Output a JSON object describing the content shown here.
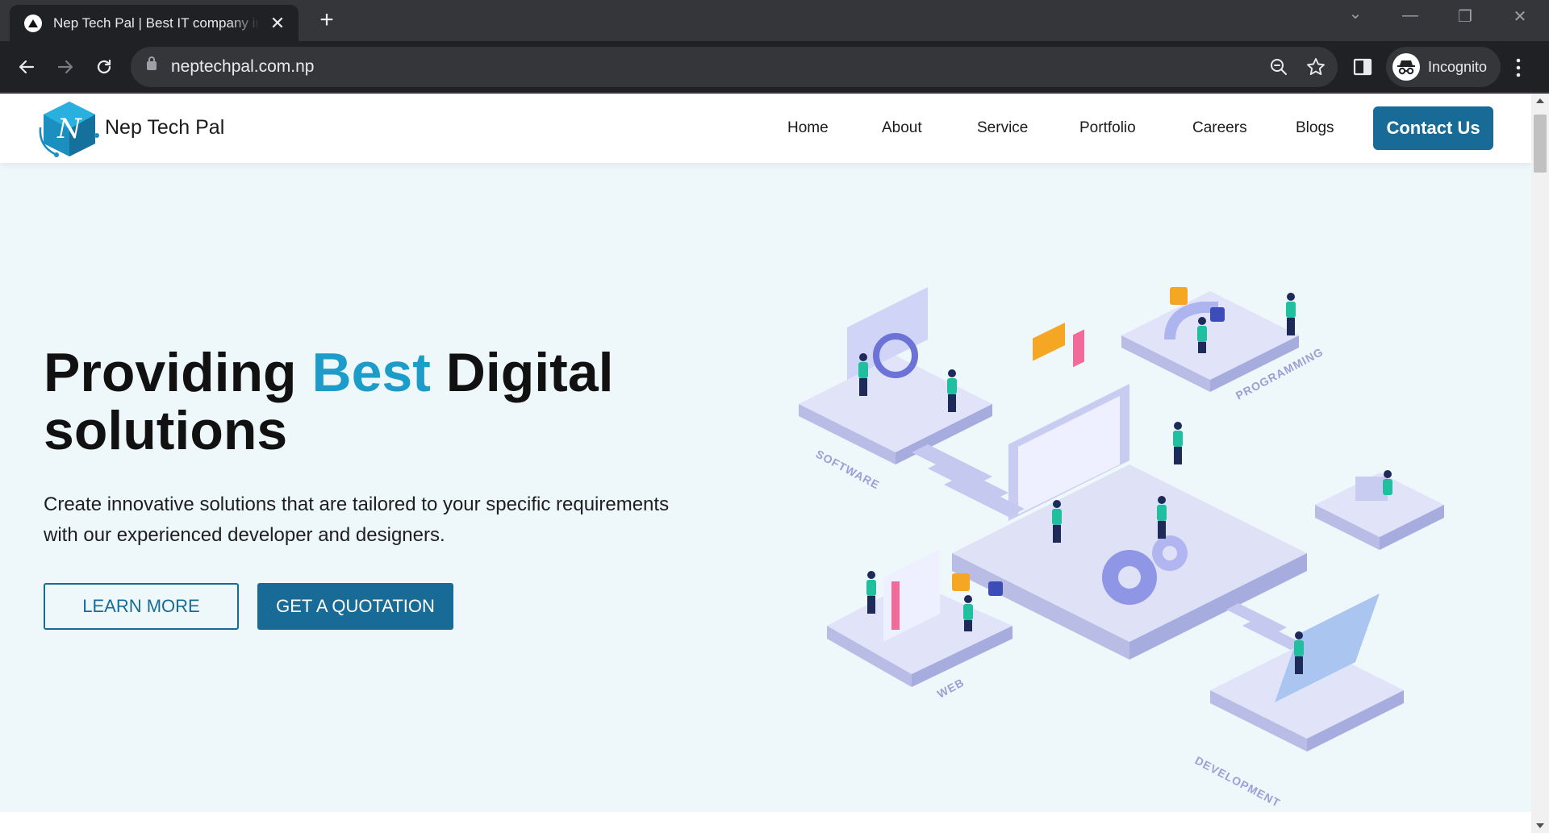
{
  "browser": {
    "tab_title": "Nep Tech Pal | Best IT company in Nepal",
    "tab_close": "✕",
    "new_tab": "+",
    "url": "neptechpal.com.np",
    "profile_label": "Incognito",
    "window_controls": {
      "tab_search": "⌄",
      "minimize": "—",
      "restore": "❐",
      "close": "✕"
    }
  },
  "site": {
    "brand": "Nep Tech Pal",
    "logo_letter": "N",
    "nav": [
      "Home",
      "About",
      "Service",
      "Portfolio",
      "Careers",
      "Blogs"
    ],
    "contact_label": "Contact Us"
  },
  "hero": {
    "title_part1": "Providing ",
    "title_accent": "Best",
    "title_part2": " Digital",
    "title_line2": "solutions",
    "subtitle": "Create innovative solutions that are tailored to your specific requirements with our experienced developer and designers.",
    "learn_more": "LEARN MORE",
    "quotation": "GET A QUOTATION",
    "illustration_labels": {
      "software": "SOFTWARE",
      "programming": "PROGRAMMING",
      "web": "WEB",
      "development": "DEVELOPMENT"
    }
  },
  "colors": {
    "brand_blue": "#176b96",
    "accent_blue": "#1c9dc9",
    "hero_bg": "#eef8fa"
  }
}
